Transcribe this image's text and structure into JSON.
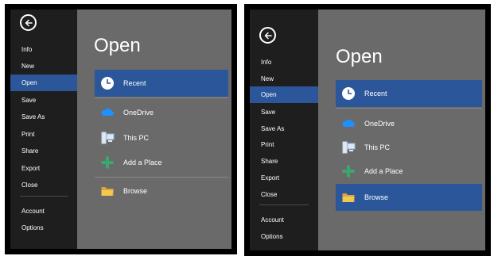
{
  "nav_left": [
    "Info",
    "New",
    "Open",
    "Save",
    "Save As",
    "Print",
    "Share",
    "Export",
    "Close",
    "Account",
    "Options"
  ],
  "nav_right": [
    "Info",
    "New",
    "Open",
    "Save",
    "Save As",
    "Print",
    "Share",
    "Export",
    "Close",
    "Account",
    "Options"
  ],
  "title": "Open",
  "locations": [
    "Recent",
    "OneDrive",
    "This PC",
    "Add a Place",
    "Browse"
  ],
  "icons": {
    "back": "back-arrow-icon",
    "recent": "clock-icon",
    "onedrive": "cloud-icon",
    "thispc": "computer-icon",
    "addplace": "plus-icon",
    "browse": "folder-icon"
  },
  "colors": {
    "accent": "#2b579a",
    "sidebar": "#1e1e1e",
    "main": "#6a6a6a",
    "text": "#ffffff"
  }
}
